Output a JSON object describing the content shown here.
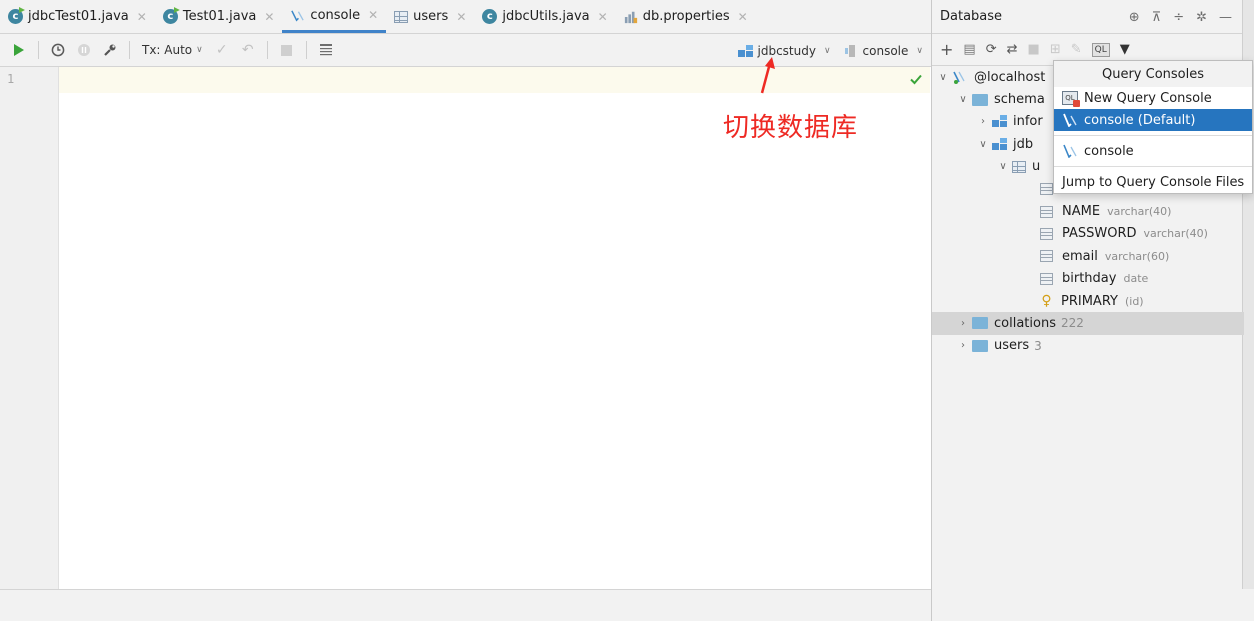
{
  "tabs": [
    {
      "label": "jdbcTest01.java",
      "icon": "java-class-runnable-icon"
    },
    {
      "label": "Test01.java",
      "icon": "java-class-runnable-icon"
    },
    {
      "label": "console",
      "icon": "console-icon",
      "active": true
    },
    {
      "label": "users",
      "icon": "table-icon"
    },
    {
      "label": "jdbcUtils.java",
      "icon": "java-class-icon"
    },
    {
      "label": "db.properties",
      "icon": "properties-icon"
    }
  ],
  "toolbar": {
    "tx_mode": "Tx: Auto",
    "datasource": "jdbcstudy",
    "session": "console"
  },
  "editor": {
    "line_number": "1",
    "annotation": "切换数据库"
  },
  "db_panel": {
    "title": "Database",
    "tree": {
      "root": "@localhost",
      "schemas_label": "schema",
      "schema_info": "infor",
      "schema_jdbc": "jdb",
      "table_u": "u",
      "columns": [
        {
          "name": "NAME",
          "type": "varchar(40)"
        },
        {
          "name": "PASSWORD",
          "type": "varchar(40)"
        },
        {
          "name": "email",
          "type": "varchar(60)"
        },
        {
          "name": "birthday",
          "type": "date"
        }
      ],
      "primary": {
        "name": "PRIMARY",
        "type": "(id)"
      },
      "collations": {
        "label": "collations",
        "count": "222"
      },
      "users": {
        "label": "users",
        "count": "3"
      }
    }
  },
  "popup": {
    "title": "Query Consoles",
    "new_console": "New Query Console",
    "console_default": "console (Default)",
    "console": "console",
    "jump": "Jump to Query Console Files"
  },
  "colors": {
    "accent": "#2675bf",
    "annotation": "#ee2a24",
    "run": "#3aa43a"
  }
}
